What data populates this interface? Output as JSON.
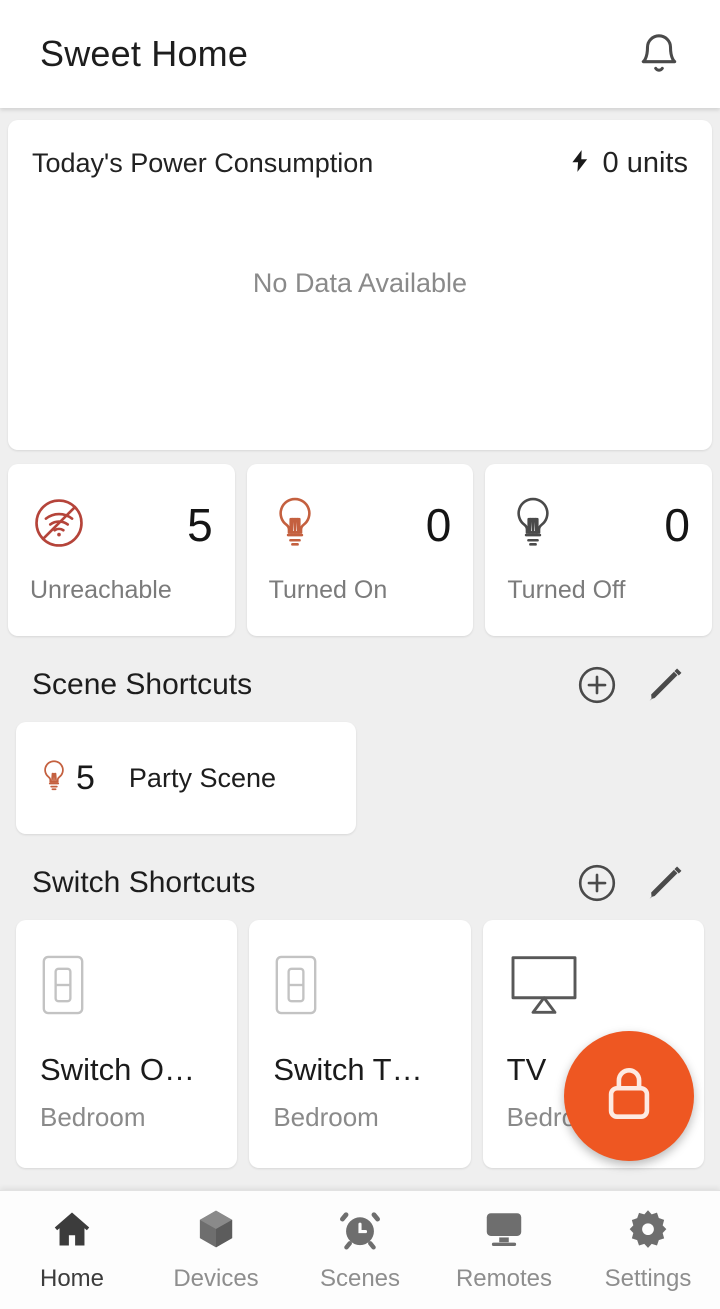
{
  "appbar": {
    "title": "Sweet Home",
    "notification_icon": "bell-icon"
  },
  "power": {
    "title": "Today's Power Consumption",
    "bolt_icon": "lightning-bolt-icon",
    "units": "0 units",
    "empty_text": "No Data Available"
  },
  "stats": [
    {
      "icon": "wifi-off-icon",
      "value": "5",
      "label": "Unreachable",
      "color": "#b5443a"
    },
    {
      "icon": "bulb-on-icon",
      "value": "0",
      "label": "Turned On",
      "color": "#c4603f"
    },
    {
      "icon": "bulb-off-icon",
      "value": "0",
      "label": "Turned Off",
      "color": "#4a4a4a"
    }
  ],
  "scene_section": {
    "title": "Scene Shortcuts",
    "add_icon": "plus-circle-icon",
    "edit_icon": "pencil-icon",
    "items": [
      {
        "icon": "bulb-on-icon",
        "count": "5",
        "name": "Party Scene"
      }
    ]
  },
  "switch_section": {
    "title": "Switch Shortcuts",
    "add_icon": "plus-circle-icon",
    "edit_icon": "pencil-icon",
    "items": [
      {
        "icon": "wall-switch-icon",
        "name": "Switch O…",
        "room": "Bedroom"
      },
      {
        "icon": "wall-switch-icon",
        "name": "Switch T…",
        "room": "Bedroom"
      },
      {
        "icon": "tv-icon",
        "name": "TV",
        "room": "Bedroom"
      }
    ]
  },
  "fab": {
    "icon": "lock-icon",
    "color": "#ee5722"
  },
  "bottom_nav": {
    "items": [
      {
        "icon": "home-icon",
        "label": "Home",
        "active": true
      },
      {
        "icon": "cube-icon",
        "label": "Devices",
        "active": false
      },
      {
        "icon": "alarm-clock-icon",
        "label": "Scenes",
        "active": false
      },
      {
        "icon": "monitor-icon",
        "label": "Remotes",
        "active": false
      },
      {
        "icon": "gear-icon",
        "label": "Settings",
        "active": false
      }
    ]
  }
}
